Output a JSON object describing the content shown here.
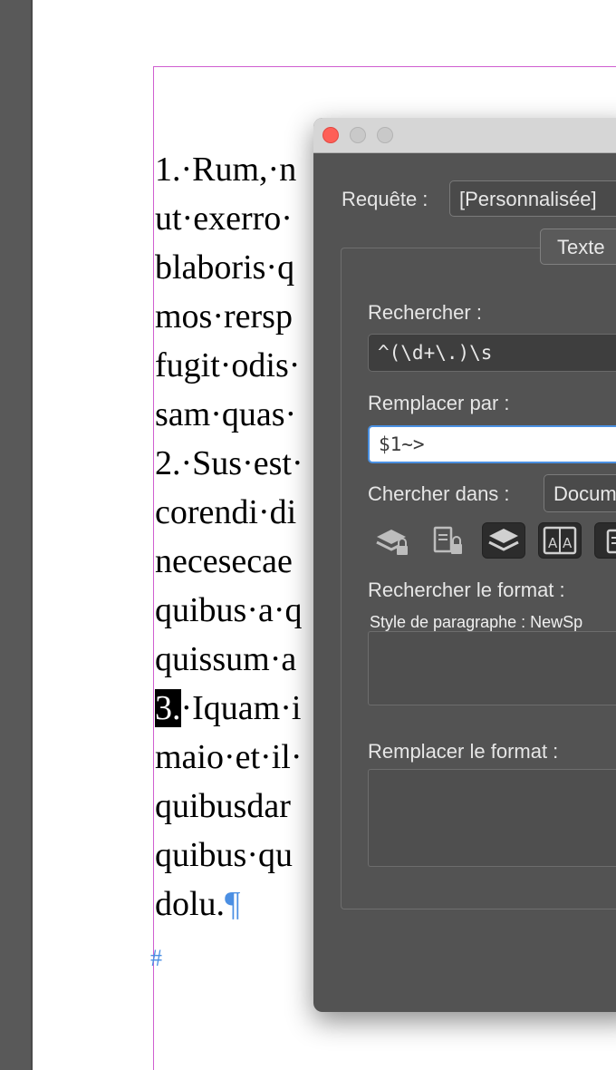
{
  "document": {
    "lines": [
      {
        "prefix": "",
        "selected": "",
        "text": "1.·Rum,·n"
      },
      {
        "prefix": "",
        "selected": "",
        "text": "ut·exerro·"
      },
      {
        "prefix": "",
        "selected": "",
        "text": "blaboris·q"
      },
      {
        "prefix": "",
        "selected": "",
        "text": "mos·rersp"
      },
      {
        "prefix": "",
        "selected": "",
        "text": "fugit·odis·"
      },
      {
        "prefix": "",
        "selected": "",
        "text": "sam·quas·"
      },
      {
        "prefix": "",
        "selected": "",
        "text": "2.·Sus·est·"
      },
      {
        "prefix": "",
        "selected": "",
        "text": "corendi·di"
      },
      {
        "prefix": "",
        "selected": "",
        "text": "necesecae"
      },
      {
        "prefix": "",
        "selected": "",
        "text": "quibus·a·q"
      },
      {
        "prefix": "",
        "selected": "",
        "text": "quissum·a"
      },
      {
        "prefix": "",
        "selected": "3.",
        "text": "·Iquam·i"
      },
      {
        "prefix": "",
        "selected": "",
        "text": "maio·et·il·"
      },
      {
        "prefix": "",
        "selected": "",
        "text": "quibusdar"
      },
      {
        "prefix": "",
        "selected": "",
        "text": "quibus·qu"
      },
      {
        "prefix": "",
        "selected": "",
        "text": "dolu."
      }
    ],
    "pilcrow": "¶",
    "end_marker": "#"
  },
  "dialog": {
    "query_label": "Requête :",
    "query_value": "[Personnalisée]",
    "tab_label": "Texte",
    "find_label": "Rechercher :",
    "find_value": "^(\\d+\\.)\\s",
    "replace_label": "Remplacer par :",
    "replace_value": "$1~>",
    "search_in_label": "Chercher dans :",
    "search_in_value": "Docum",
    "find_format_label": "Rechercher le format :",
    "find_format_value": "Style de paragraphe : NewSp",
    "replace_format_label": "Remplacer le format :",
    "icons": [
      "include-locked-layers-icon",
      "include-locked-stories-icon",
      "include-hidden-layers-icon",
      "include-master-pages-icon",
      "include-footnotes-icon"
    ]
  },
  "colors": {
    "margin_guide": "#cf5fd1",
    "hidden_chars": "#4b8fe3",
    "close_button": "#fe5f57",
    "focus_ring": "#4a90e2"
  }
}
